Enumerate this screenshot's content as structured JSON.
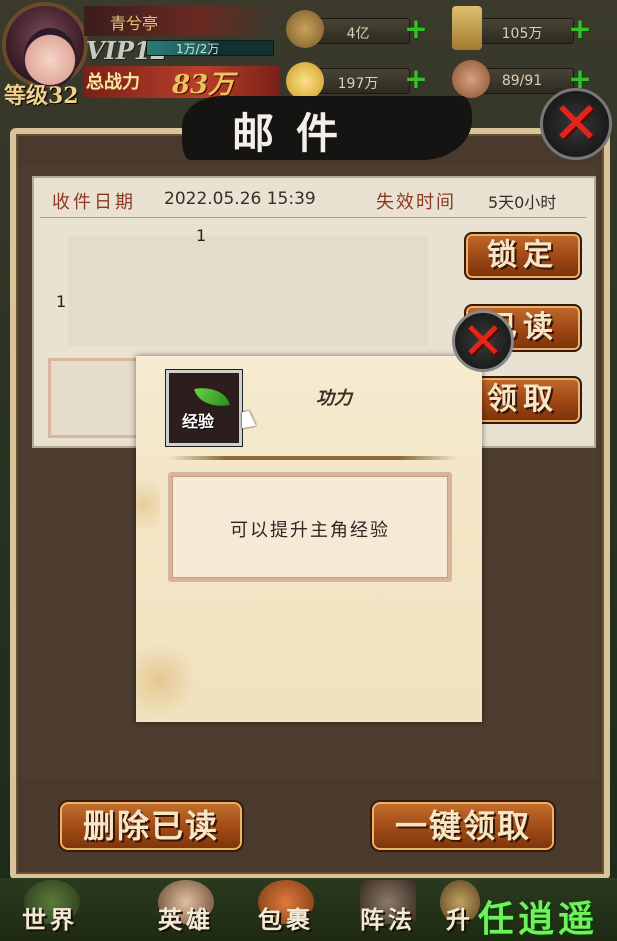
{
  "hud": {
    "player_name": "青兮亭",
    "vip": "VIP12",
    "vip_progress": "1万/2万",
    "vip_progress_fraction": 0.5,
    "level": "等级32",
    "power_label": "总战力",
    "power_value": "83万",
    "resources": [
      {
        "icon": "copper-coins-icon",
        "value": "4亿"
      },
      {
        "icon": "scroll-token-icon",
        "value": "105万"
      },
      {
        "icon": "gold-ingot-icon",
        "value": "197万"
      },
      {
        "icon": "muscle-stamina-icon",
        "value": "89/91"
      }
    ]
  },
  "mail": {
    "title": "邮件",
    "received_label": "收件日期",
    "received_date": "2022.05.26 15:39",
    "expire_label": "失效时间",
    "expire_value": "5天0小时",
    "body_line_a": "1",
    "body_line_b": "1",
    "lock_button": "锁定",
    "read_button": "已读",
    "claim_button": "领取",
    "delete_read_button": "删除已读",
    "claim_all_button": "一键领取"
  },
  "tooltip": {
    "item_icon_label": "经验",
    "item_name": "功力",
    "description": "可以提升主角经验"
  },
  "nav": {
    "items": [
      "世界",
      "英雄",
      "包裹",
      "阵法",
      "升"
    ],
    "watermark": "任逍遥"
  },
  "colors": {
    "accent_button": "#9c4715",
    "close_red": "#e0261b",
    "paper": "#e9e2d3",
    "watermark_green": "#6df25c"
  }
}
